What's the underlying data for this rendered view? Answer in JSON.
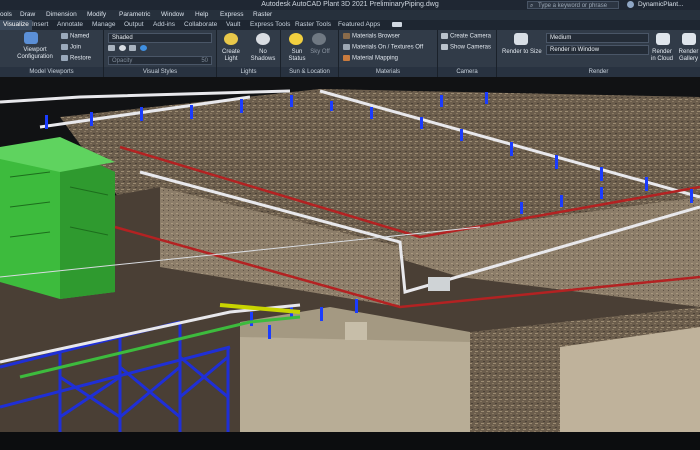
{
  "window": {
    "title": "Autodesk AutoCAD Plant 3D 2021   PreliminaryPiping.dwg"
  },
  "search": {
    "placeholder": "Type a keyword or phrase"
  },
  "user": {
    "name": "DynamicPlant..."
  },
  "menu": [
    "ools",
    "Draw",
    "Dimension",
    "Modify",
    "Parametric",
    "Window",
    "Help",
    "Express",
    "Raster"
  ],
  "tabs": [
    "Visualize",
    "Insert",
    "Annotate",
    "Manage",
    "Output",
    "Add-ins",
    "Collaborate",
    "Vault",
    "Express Tools",
    "Raster Tools",
    "Featured Apps"
  ],
  "ribbon": {
    "model_viewports": {
      "label": "Model Viewports",
      "viewport_config": "Viewport Configuration",
      "named": "Named",
      "join": "Join",
      "restore": "Restore"
    },
    "visual_styles": {
      "label": "Visual Styles",
      "style": "Shaded",
      "opacity": "Opacity",
      "opacity_value": "50"
    },
    "lights": {
      "label": "Lights",
      "create_light": "Create Light",
      "no_shadows": "No Shadows"
    },
    "sun_location": {
      "label": "Sun & Location",
      "sun_status": "Sun Status",
      "sky_off": "Sky Off"
    },
    "materials": {
      "label": "Materials",
      "browser": "Materials Browser",
      "on_textures_off": "Materials On / Textures Off",
      "mapping": "Material Mapping"
    },
    "camera": {
      "label": "Camera",
      "create": "Create Camera",
      "show": "Show Cameras"
    },
    "render": {
      "label": "Render",
      "render_to_size": "Render to Size",
      "quality": "Medium",
      "target": "Render in Window",
      "cloud": "Render in Cloud",
      "gallery": "Render Gallery"
    }
  },
  "colors": {
    "equipment": "#3dbb3d",
    "pipe_rack": "#1f2fd6",
    "support_blue": "#1a3cff",
    "pipe_white": "#e8e8ec",
    "pipe_red": "#b32222",
    "pipe_yellow": "#c8d400"
  }
}
